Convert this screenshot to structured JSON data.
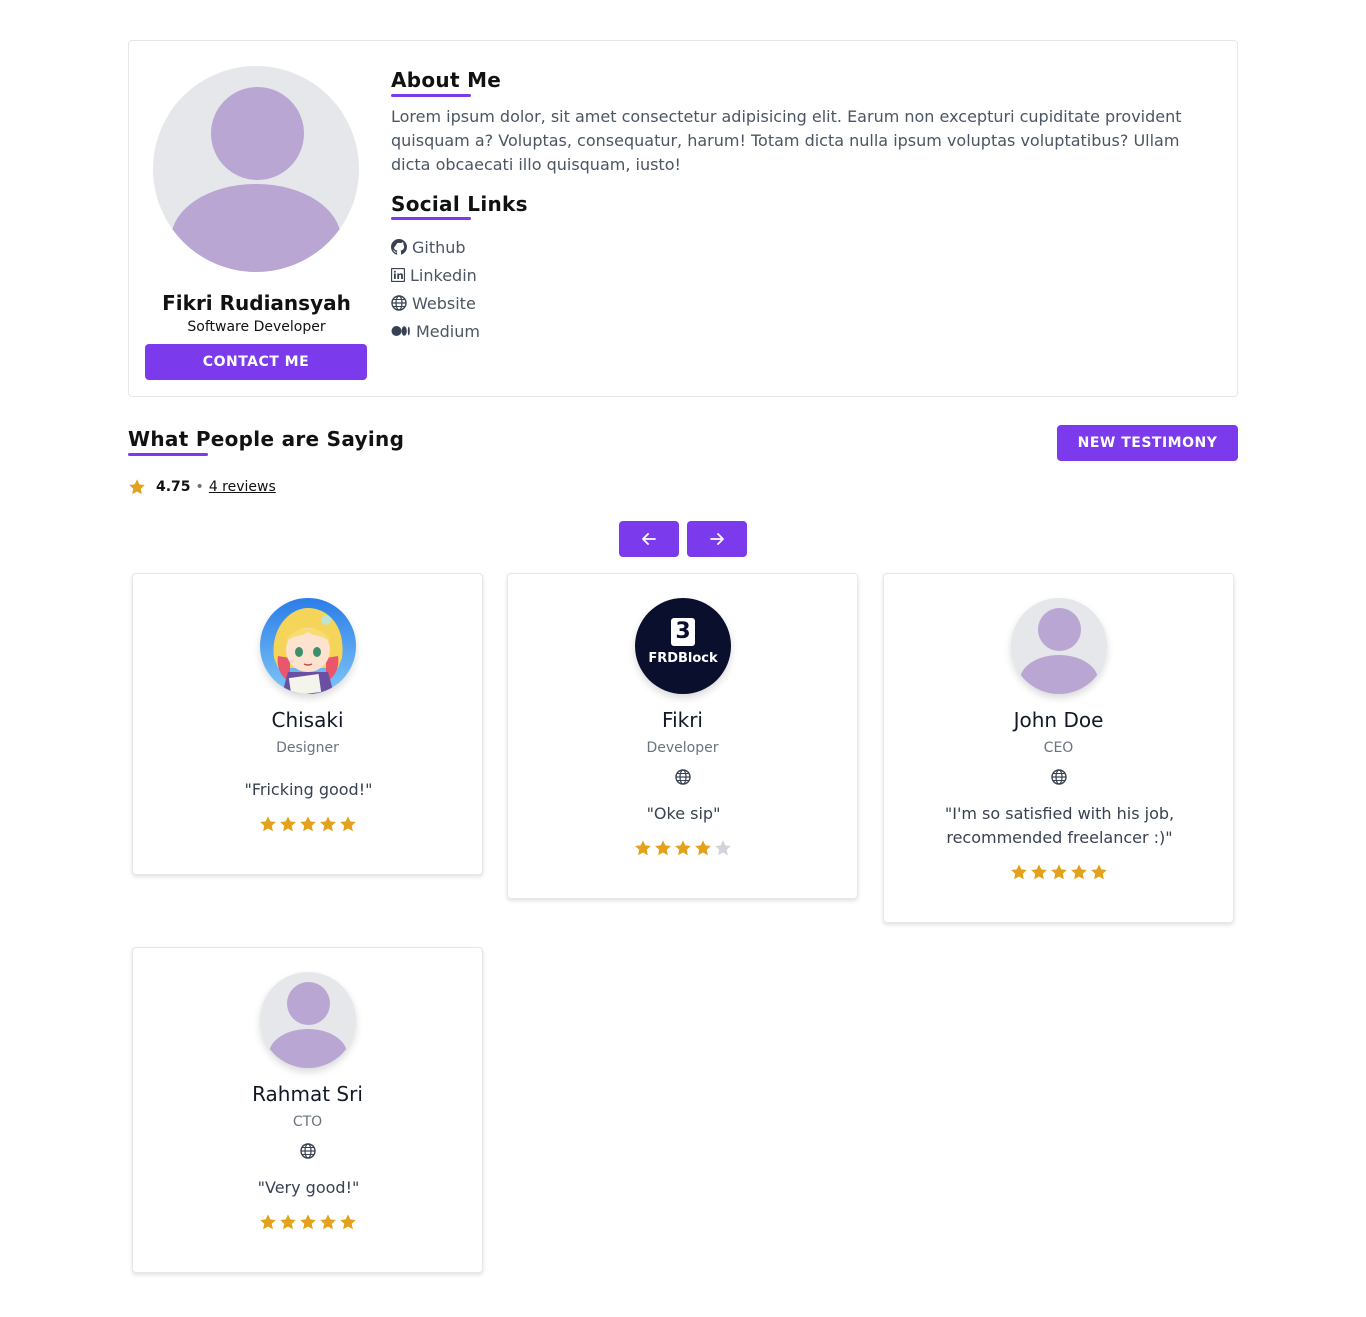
{
  "profile": {
    "name": "Fikri Rudiansyah",
    "role": "Software Developer",
    "contact_label": "CONTACT ME",
    "avatar_icon": "default-user-avatar"
  },
  "about": {
    "heading": "About Me",
    "text": "Lorem ipsum dolor, sit amet consectetur adipisicing elit. Earum non excepturi cupiditate provident quisquam a? Voluptas, consequatur, harum! Totam dicta nulla ipsum voluptas voluptatibus? Ullam dicta obcaecati illo quisquam, iusto!"
  },
  "social": {
    "heading": "Social Links",
    "links": [
      {
        "label": "Github",
        "icon": "github-icon"
      },
      {
        "label": "Linkedin",
        "icon": "linkedin-icon"
      },
      {
        "label": "Website",
        "icon": "globe-icon"
      },
      {
        "label": "Medium",
        "icon": "medium-icon"
      }
    ]
  },
  "testimonials": {
    "heading": "What People are Saying",
    "new_label": "NEW TESTIMONY",
    "rating": "4.75",
    "separator": "•",
    "reviews_label": "4 reviews",
    "prev_icon": "arrow-left-icon",
    "next_icon": "arrow-right-icon",
    "items": [
      {
        "name": "Chisaki",
        "role": "Designer",
        "quote": "\"Fricking good!\"",
        "stars": 5,
        "avatar": "anime-character-avatar",
        "website": false
      },
      {
        "name": "Fikri",
        "role": "Developer",
        "quote": "\"Oke sip\"",
        "stars": 4,
        "avatar": "frdblock-logo-avatar",
        "logo_text": "FRDBlock",
        "logo_letter": "3",
        "website": true
      },
      {
        "name": "John Doe",
        "role": "CEO",
        "quote": "\"I'm so satisfied with his job, recommended freelancer :)\"",
        "stars": 5,
        "avatar": "default-user-avatar",
        "website": true
      },
      {
        "name": "Rahmat Sri",
        "role": "CTO",
        "quote": "\"Very good!\"",
        "stars": 5,
        "avatar": "default-user-avatar",
        "website": true
      }
    ]
  },
  "colors": {
    "accent": "#7c3aed",
    "star_filled": "#e4a11b",
    "star_empty": "#d1d5db",
    "avatar_placeholder": "#baa6d3"
  }
}
